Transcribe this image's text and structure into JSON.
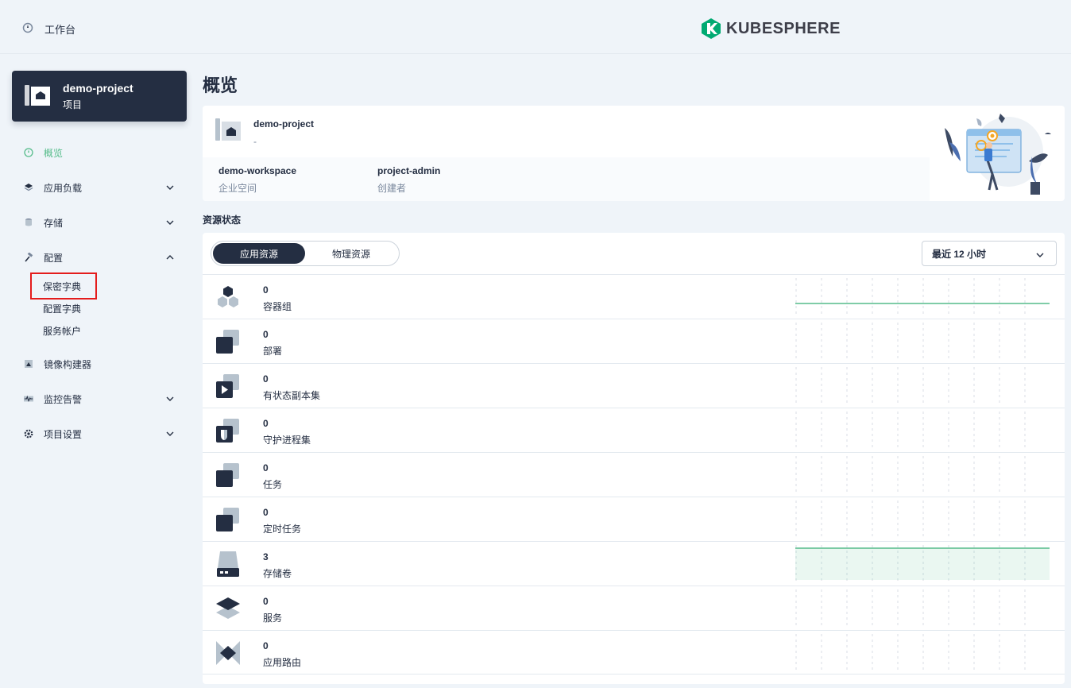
{
  "header": {
    "workbench_label": "工作台",
    "logo_text": "KUBESPHERE"
  },
  "project": {
    "name": "demo-project",
    "type": "项目"
  },
  "nav": {
    "items": [
      {
        "label": "概览",
        "icon": "dashboard-icon",
        "active": true
      },
      {
        "label": "应用负载",
        "icon": "appcenter-icon"
      },
      {
        "label": "存储",
        "icon": "storage-icon"
      },
      {
        "label": "配置",
        "icon": "hammer-icon"
      },
      {
        "label": "镜像构建器",
        "icon": "image-builder-icon"
      },
      {
        "label": "监控告警",
        "icon": "monitor-icon"
      },
      {
        "label": "项目设置",
        "icon": "gear-icon"
      }
    ],
    "config_sub": [
      "保密字典",
      "配置字典",
      "服务帐户"
    ]
  },
  "page": {
    "title": "概览"
  },
  "info": {
    "name": "demo-project",
    "description": "-",
    "workspace": "demo-workspace",
    "workspace_label": "企业空间",
    "creator": "project-admin",
    "creator_label": "创建者"
  },
  "resources": {
    "section_title": "资源状态",
    "tabs": [
      "应用资源",
      "物理资源"
    ],
    "time_range": "最近 12 小时",
    "rows": [
      {
        "count": "0",
        "label": "容器组",
        "icon": "pods-icon"
      },
      {
        "count": "0",
        "label": "部署",
        "icon": "deployment-icon"
      },
      {
        "count": "0",
        "label": "有状态副本集",
        "icon": "statefulset-icon"
      },
      {
        "count": "0",
        "label": "守护进程集",
        "icon": "daemonset-icon"
      },
      {
        "count": "0",
        "label": "任务",
        "icon": "job-icon"
      },
      {
        "count": "0",
        "label": "定时任务",
        "icon": "cronjob-icon"
      },
      {
        "count": "3",
        "label": "存储卷",
        "icon": "volume-icon"
      },
      {
        "count": "0",
        "label": "服务",
        "icon": "service-icon"
      },
      {
        "count": "0",
        "label": "应用路由",
        "icon": "ingress-icon"
      }
    ]
  },
  "colors": {
    "accent": "#55bc8a",
    "dark": "#242e42",
    "highlight": "#e41c1c"
  }
}
